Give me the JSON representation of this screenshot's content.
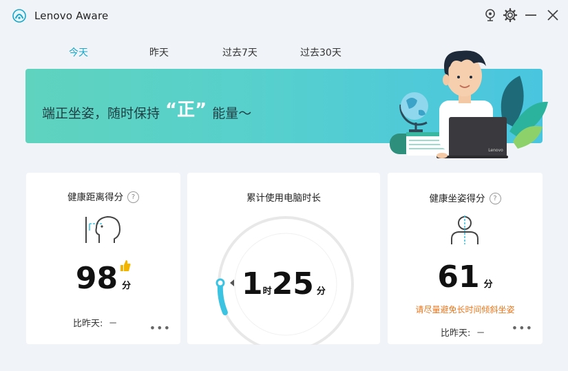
{
  "app": {
    "title": "Lenovo Aware"
  },
  "tabs": [
    {
      "label": "今天"
    },
    {
      "label": "昨天"
    },
    {
      "label": "过去7天"
    },
    {
      "label": "过去30天"
    }
  ],
  "banner": {
    "text_before": "端正坐姿，随时保持",
    "quote_open": "“",
    "emphasis": "正",
    "quote_close": "”",
    "text_after": "能量～",
    "laptop_brand": "Lenovo"
  },
  "cards": {
    "distance": {
      "title": "健康距离得分",
      "help": "?",
      "score": "98",
      "unit": "分",
      "compare_label": "比昨天:",
      "compare_value": "－",
      "more": "•••"
    },
    "usage": {
      "title": "累计使用电脑时长",
      "hours": "1",
      "hours_unit": "时",
      "minutes": "25",
      "minutes_unit": "分"
    },
    "posture": {
      "title": "健康坐姿得分",
      "help": "?",
      "score": "61",
      "unit": "分",
      "warning": "请尽量避免长时间倾斜坐姿",
      "compare_label": "比昨天:",
      "compare_value": "－",
      "more": "•••"
    }
  },
  "colors": {
    "accent": "#1aa6c9",
    "warning": "#e8761c",
    "gauge": "#3cc3e2"
  },
  "icons": [
    "app-logo-icon",
    "camera-icon",
    "gear-icon",
    "minimize-icon",
    "close-icon",
    "thumbs-up-icon",
    "face-distance-icon",
    "posture-person-icon"
  ]
}
